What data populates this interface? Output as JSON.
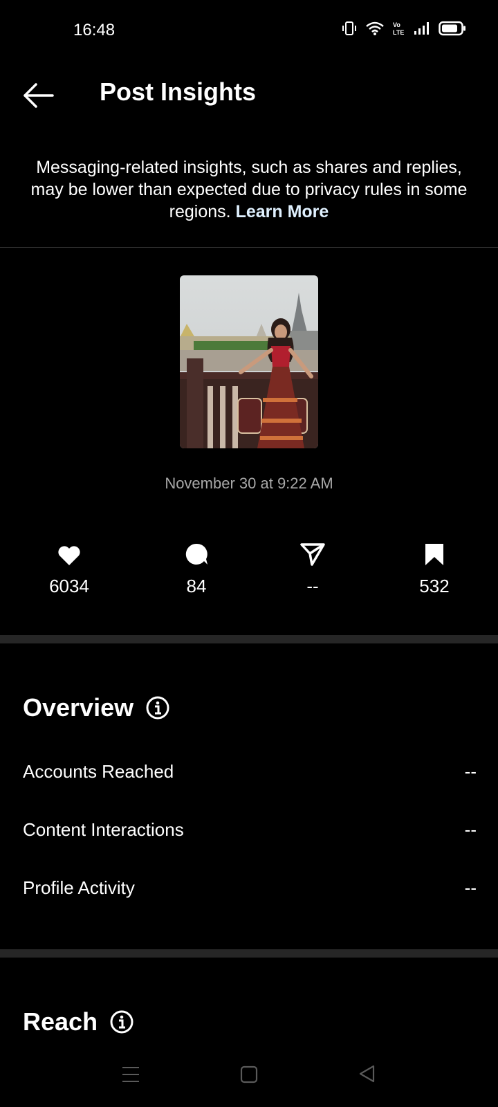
{
  "status": {
    "time": "16:48",
    "battery_label": "battery",
    "network_label": "Vo LTE"
  },
  "header": {
    "title": "Post Insights"
  },
  "notice": {
    "text": "Messaging-related insights, such as shares and replies, may be lower than expected due to privacy rules in some regions.",
    "link": "Learn More"
  },
  "post": {
    "date": "November 30 at 9:22 AM"
  },
  "metrics": [
    {
      "icon": "heart-icon",
      "value": "6034"
    },
    {
      "icon": "comment-icon",
      "value": "84"
    },
    {
      "icon": "share-icon",
      "value": "--"
    },
    {
      "icon": "bookmark-icon",
      "value": "532"
    }
  ],
  "overview": {
    "title": "Overview",
    "rows": [
      {
        "label": "Accounts Reached",
        "value": "--"
      },
      {
        "label": "Content Interactions",
        "value": "--"
      },
      {
        "label": "Profile Activity",
        "value": "--"
      }
    ]
  },
  "reach": {
    "title": "Reach"
  },
  "colors": {
    "background": "#000000",
    "link": "#e0f1ff",
    "muted": "#a8a8a8",
    "divider": "#262626"
  }
}
